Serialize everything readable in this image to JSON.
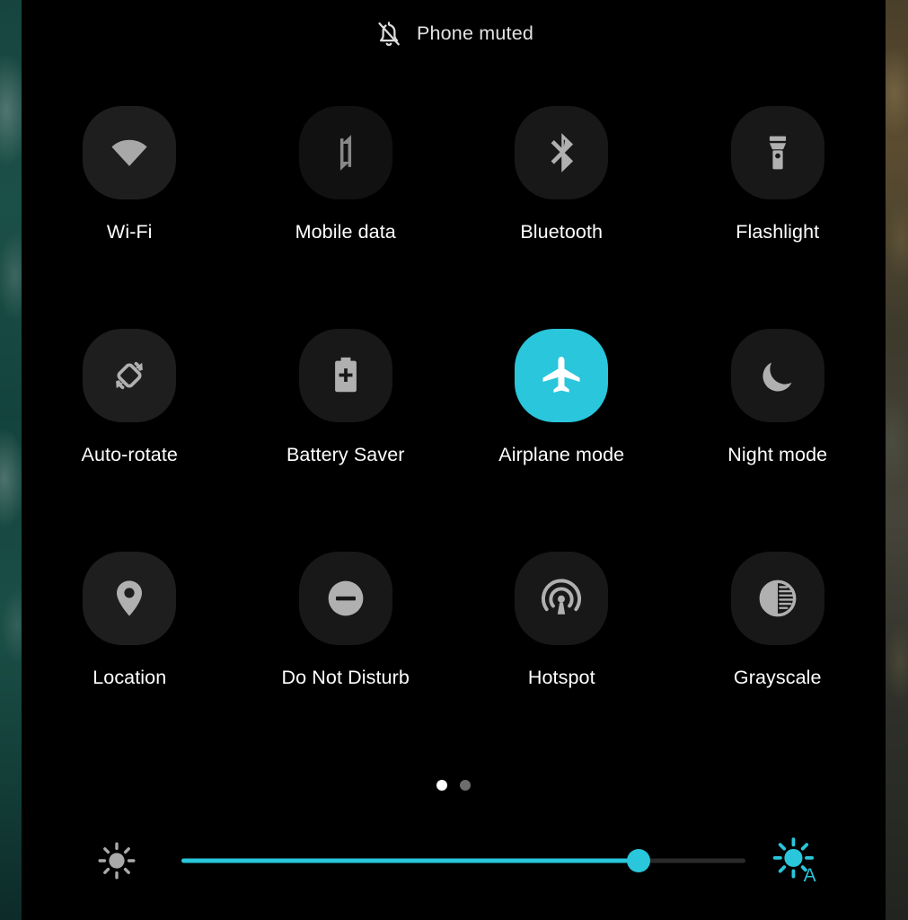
{
  "header": {
    "icon": "bell-muted-icon",
    "text": "Phone muted"
  },
  "colors": {
    "accent": "#29c6dc",
    "panel_background": "#000000",
    "tile_off_background": "#1e1e1e",
    "tile_icon": "#b0b0b0",
    "tile_icon_active": "#ffffff",
    "label_text": "#ffffff",
    "header_text": "#e3e3e3"
  },
  "tiles": [
    {
      "id": "wifi",
      "label": "Wi-Fi",
      "icon": "wifi-icon",
      "state": "off",
      "shade": "bright"
    },
    {
      "id": "mobile-data",
      "label": "Mobile data",
      "icon": "mobile-data-icon",
      "state": "off",
      "shade": "dimmer"
    },
    {
      "id": "bluetooth",
      "label": "Bluetooth",
      "icon": "bluetooth-icon",
      "state": "off",
      "shade": "dim"
    },
    {
      "id": "flashlight",
      "label": "Flashlight",
      "icon": "flashlight-icon",
      "state": "off",
      "shade": "dim"
    },
    {
      "id": "auto-rotate",
      "label": "Auto-rotate",
      "icon": "auto-rotate-icon",
      "state": "off",
      "shade": "bright"
    },
    {
      "id": "battery-saver",
      "label": "Battery Saver",
      "icon": "battery-plus-icon",
      "state": "off",
      "shade": "dim"
    },
    {
      "id": "airplane-mode",
      "label": "Airplane mode",
      "icon": "airplane-icon",
      "state": "on",
      "shade": "on"
    },
    {
      "id": "night-mode",
      "label": "Night mode",
      "icon": "moon-icon",
      "state": "off",
      "shade": "dim"
    },
    {
      "id": "location",
      "label": "Location",
      "icon": "location-pin-icon",
      "state": "off",
      "shade": "bright"
    },
    {
      "id": "do-not-disturb",
      "label": "Do Not Disturb",
      "icon": "minus-circle-icon",
      "state": "off",
      "shade": "dim"
    },
    {
      "id": "hotspot",
      "label": "Hotspot",
      "icon": "hotspot-icon",
      "state": "off",
      "shade": "dim"
    },
    {
      "id": "grayscale",
      "label": "Grayscale",
      "icon": "grayscale-icon",
      "state": "off",
      "shade": "dim"
    }
  ],
  "pager": {
    "total_pages": 2,
    "current_page": 1
  },
  "brightness": {
    "low_icon": "sun-low-icon",
    "auto_icon": "sun-auto-icon",
    "auto_label": "A",
    "value_percent": 81,
    "auto_enabled": true
  }
}
